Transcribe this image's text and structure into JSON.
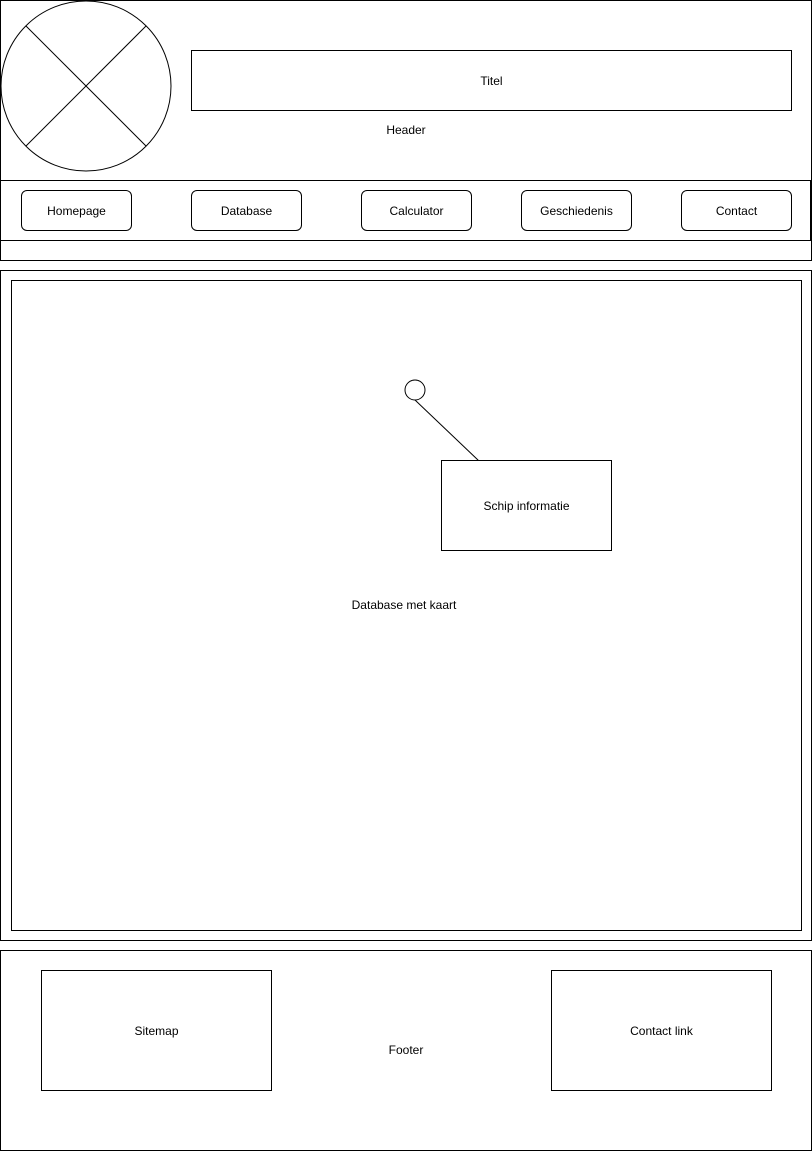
{
  "header": {
    "title_box_label": "Titel",
    "label": "Header",
    "logo_icon": "image-placeholder-icon"
  },
  "nav": {
    "items": [
      {
        "label": "Homepage"
      },
      {
        "label": "Database"
      },
      {
        "label": "Calculator"
      },
      {
        "label": "Geschiedenis"
      },
      {
        "label": "Contact"
      }
    ]
  },
  "main": {
    "label": "Database met kaart",
    "ship_info_label": "Schip informatie",
    "marker_icon": "map-marker-icon"
  },
  "footer": {
    "label": "Footer",
    "sitemap_label": "Sitemap",
    "contact_link_label": "Contact link"
  }
}
